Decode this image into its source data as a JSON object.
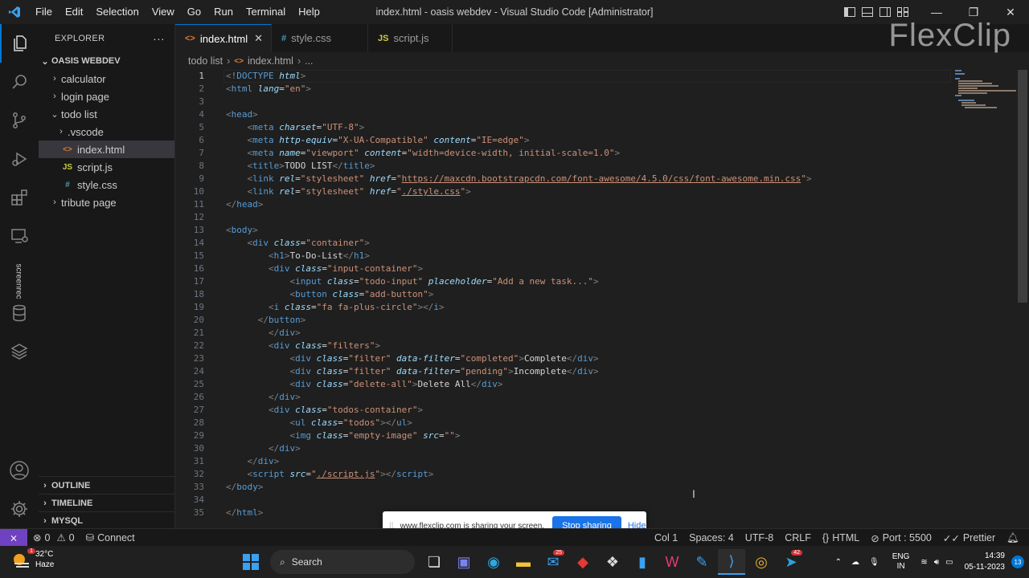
{
  "window": {
    "title": "index.html - oasis webdev - Visual Studio Code [Administrator]",
    "menu": [
      "File",
      "Edit",
      "Selection",
      "View",
      "Go",
      "Run",
      "Terminal",
      "Help"
    ],
    "controls": {
      "minimize": "—",
      "restore": "❐",
      "close": "✕"
    }
  },
  "activity_bar": {
    "items": [
      "files-icon",
      "search-icon",
      "source-control-icon",
      "run-debug-icon",
      "extensions-icon",
      "remote-explorer-icon",
      "database-icon",
      "stack-icon"
    ],
    "bottom": [
      "account-icon",
      "settings-gear-icon"
    ],
    "screenrec_label": "screenrec"
  },
  "sidebar": {
    "title": "EXPLORER",
    "more": "···",
    "root": "OASIS WEBDEV",
    "tree": [
      {
        "label": "calculator",
        "kind": "folder",
        "open": false,
        "depth": 1
      },
      {
        "label": "login page",
        "kind": "folder",
        "open": false,
        "depth": 1
      },
      {
        "label": "todo list",
        "kind": "folder",
        "open": true,
        "depth": 1
      },
      {
        "label": ".vscode",
        "kind": "folder",
        "open": false,
        "depth": 2
      },
      {
        "label": "index.html",
        "kind": "html",
        "depth": 2,
        "selected": true
      },
      {
        "label": "script.js",
        "kind": "js",
        "depth": 2
      },
      {
        "label": "style.css",
        "kind": "css",
        "depth": 2
      },
      {
        "label": "tribute page",
        "kind": "folder",
        "open": false,
        "depth": 1
      }
    ],
    "sections": [
      "OUTLINE",
      "TIMELINE",
      "MYSQL"
    ]
  },
  "tabs": [
    {
      "label": "index.html",
      "icon": "<>",
      "active": true,
      "close": "✕"
    },
    {
      "label": "style.css",
      "icon": "#",
      "active": false
    },
    {
      "label": "script.js",
      "icon": "JS",
      "active": false
    }
  ],
  "breadcrumb": [
    "todo list",
    "index.html",
    "..."
  ],
  "editor": {
    "current_line": 1,
    "lines": [
      [
        [
          "p",
          "<"
        ],
        [
          "t",
          "!DOCTYPE"
        ],
        [
          "x",
          " "
        ],
        [
          "a",
          "html"
        ],
        [
          "p",
          ">"
        ]
      ],
      [
        [
          "p",
          "<"
        ],
        [
          "t",
          "html"
        ],
        [
          "x",
          " "
        ],
        [
          "a",
          "lang"
        ],
        [
          "x",
          "="
        ],
        [
          "s",
          "\"en\""
        ],
        [
          "p",
          ">"
        ]
      ],
      [],
      [
        [
          "p",
          "<"
        ],
        [
          "t",
          "head"
        ],
        [
          "p",
          ">"
        ]
      ],
      [
        [
          "x",
          "    "
        ],
        [
          "p",
          "<"
        ],
        [
          "t",
          "meta"
        ],
        [
          "x",
          " "
        ],
        [
          "a",
          "charset"
        ],
        [
          "x",
          "="
        ],
        [
          "s",
          "\"UTF-8\""
        ],
        [
          "p",
          ">"
        ]
      ],
      [
        [
          "x",
          "    "
        ],
        [
          "p",
          "<"
        ],
        [
          "t",
          "meta"
        ],
        [
          "x",
          " "
        ],
        [
          "a",
          "http-equiv"
        ],
        [
          "x",
          "="
        ],
        [
          "s",
          "\"X-UA-Compatible\""
        ],
        [
          "x",
          " "
        ],
        [
          "a",
          "content"
        ],
        [
          "x",
          "="
        ],
        [
          "s",
          "\"IE=edge\""
        ],
        [
          "p",
          ">"
        ]
      ],
      [
        [
          "x",
          "    "
        ],
        [
          "p",
          "<"
        ],
        [
          "t",
          "meta"
        ],
        [
          "x",
          " "
        ],
        [
          "a",
          "name"
        ],
        [
          "x",
          "="
        ],
        [
          "s",
          "\"viewport\""
        ],
        [
          "x",
          " "
        ],
        [
          "a",
          "content"
        ],
        [
          "x",
          "="
        ],
        [
          "s",
          "\"width=device-width, initial-scale=1.0\""
        ],
        [
          "p",
          ">"
        ]
      ],
      [
        [
          "x",
          "    "
        ],
        [
          "p",
          "<"
        ],
        [
          "t",
          "title"
        ],
        [
          "p",
          ">"
        ],
        [
          "x",
          "TODO LIST"
        ],
        [
          "p",
          "</"
        ],
        [
          "t",
          "title"
        ],
        [
          "p",
          ">"
        ]
      ],
      [
        [
          "x",
          "    "
        ],
        [
          "p",
          "<"
        ],
        [
          "t",
          "link"
        ],
        [
          "x",
          " "
        ],
        [
          "a",
          "rel"
        ],
        [
          "x",
          "="
        ],
        [
          "s",
          "\"stylesheet\""
        ],
        [
          "x",
          " "
        ],
        [
          "a",
          "href"
        ],
        [
          "x",
          "="
        ],
        [
          "s",
          "\""
        ],
        [
          "su",
          "https://maxcdn.bootstrapcdn.com/font-awesome/4.5.0/css/font-awesome.min.css"
        ],
        [
          "s",
          "\""
        ],
        [
          "p",
          ">"
        ]
      ],
      [
        [
          "x",
          "    "
        ],
        [
          "p",
          "<"
        ],
        [
          "t",
          "link"
        ],
        [
          "x",
          " "
        ],
        [
          "a",
          "rel"
        ],
        [
          "x",
          "="
        ],
        [
          "s",
          "\"stylesheet\""
        ],
        [
          "x",
          " "
        ],
        [
          "a",
          "href"
        ],
        [
          "x",
          "="
        ],
        [
          "s",
          "\""
        ],
        [
          "su",
          "./style.css"
        ],
        [
          "s",
          "\""
        ],
        [
          "p",
          ">"
        ]
      ],
      [
        [
          "p",
          "</"
        ],
        [
          "t",
          "head"
        ],
        [
          "p",
          ">"
        ]
      ],
      [],
      [
        [
          "p",
          "<"
        ],
        [
          "t",
          "body"
        ],
        [
          "p",
          ">"
        ]
      ],
      [
        [
          "x",
          "    "
        ],
        [
          "p",
          "<"
        ],
        [
          "t",
          "div"
        ],
        [
          "x",
          " "
        ],
        [
          "a",
          "class"
        ],
        [
          "x",
          "="
        ],
        [
          "s",
          "\"container\""
        ],
        [
          "p",
          ">"
        ]
      ],
      [
        [
          "x",
          "        "
        ],
        [
          "p",
          "<"
        ],
        [
          "t",
          "h1"
        ],
        [
          "p",
          ">"
        ],
        [
          "x",
          "To-Do-List"
        ],
        [
          "p",
          "</"
        ],
        [
          "t",
          "h1"
        ],
        [
          "p",
          ">"
        ]
      ],
      [
        [
          "x",
          "        "
        ],
        [
          "p",
          "<"
        ],
        [
          "t",
          "div"
        ],
        [
          "x",
          " "
        ],
        [
          "a",
          "class"
        ],
        [
          "x",
          "="
        ],
        [
          "s",
          "\"input-container\""
        ],
        [
          "p",
          ">"
        ]
      ],
      [
        [
          "x",
          "            "
        ],
        [
          "p",
          "<"
        ],
        [
          "t",
          "input"
        ],
        [
          "x",
          " "
        ],
        [
          "a",
          "class"
        ],
        [
          "x",
          "="
        ],
        [
          "s",
          "\"todo-input\""
        ],
        [
          "x",
          " "
        ],
        [
          "a",
          "placeholder"
        ],
        [
          "x",
          "="
        ],
        [
          "s",
          "\"Add a new task...\""
        ],
        [
          "p",
          ">"
        ]
      ],
      [
        [
          "x",
          "            "
        ],
        [
          "p",
          "<"
        ],
        [
          "t",
          "button"
        ],
        [
          "x",
          " "
        ],
        [
          "a",
          "class"
        ],
        [
          "x",
          "="
        ],
        [
          "s",
          "\"add-button\""
        ],
        [
          "p",
          ">"
        ]
      ],
      [
        [
          "x",
          "        "
        ],
        [
          "p",
          "<"
        ],
        [
          "t",
          "i"
        ],
        [
          "x",
          " "
        ],
        [
          "a",
          "class"
        ],
        [
          "x",
          "="
        ],
        [
          "s",
          "\"fa fa-plus-circle\""
        ],
        [
          "p",
          "></"
        ],
        [
          "t",
          "i"
        ],
        [
          "p",
          ">"
        ]
      ],
      [
        [
          "x",
          "      "
        ],
        [
          "p",
          "</"
        ],
        [
          "t",
          "button"
        ],
        [
          "p",
          ">"
        ]
      ],
      [
        [
          "x",
          "        "
        ],
        [
          "p",
          "</"
        ],
        [
          "t",
          "div"
        ],
        [
          "p",
          ">"
        ]
      ],
      [
        [
          "x",
          "        "
        ],
        [
          "p",
          "<"
        ],
        [
          "t",
          "div"
        ],
        [
          "x",
          " "
        ],
        [
          "a",
          "class"
        ],
        [
          "x",
          "="
        ],
        [
          "s",
          "\"filters\""
        ],
        [
          "p",
          ">"
        ]
      ],
      [
        [
          "x",
          "            "
        ],
        [
          "p",
          "<"
        ],
        [
          "t",
          "div"
        ],
        [
          "x",
          " "
        ],
        [
          "a",
          "class"
        ],
        [
          "x",
          "="
        ],
        [
          "s",
          "\"filter\""
        ],
        [
          "x",
          " "
        ],
        [
          "a",
          "data-filter"
        ],
        [
          "x",
          "="
        ],
        [
          "s",
          "\"completed\""
        ],
        [
          "p",
          ">"
        ],
        [
          "x",
          "Complete"
        ],
        [
          "p",
          "</"
        ],
        [
          "t",
          "div"
        ],
        [
          "p",
          ">"
        ]
      ],
      [
        [
          "x",
          "            "
        ],
        [
          "p",
          "<"
        ],
        [
          "t",
          "div"
        ],
        [
          "x",
          " "
        ],
        [
          "a",
          "class"
        ],
        [
          "x",
          "="
        ],
        [
          "s",
          "\"filter\""
        ],
        [
          "x",
          " "
        ],
        [
          "a",
          "data-filter"
        ],
        [
          "x",
          "="
        ],
        [
          "s",
          "\"pending\""
        ],
        [
          "p",
          ">"
        ],
        [
          "x",
          "Incomplete"
        ],
        [
          "p",
          "</"
        ],
        [
          "t",
          "div"
        ],
        [
          "p",
          ">"
        ]
      ],
      [
        [
          "x",
          "            "
        ],
        [
          "p",
          "<"
        ],
        [
          "t",
          "div"
        ],
        [
          "x",
          " "
        ],
        [
          "a",
          "class"
        ],
        [
          "x",
          "="
        ],
        [
          "s",
          "\"delete-all\""
        ],
        [
          "p",
          ">"
        ],
        [
          "x",
          "Delete All"
        ],
        [
          "p",
          "</"
        ],
        [
          "t",
          "div"
        ],
        [
          "p",
          ">"
        ]
      ],
      [
        [
          "x",
          "        "
        ],
        [
          "p",
          "</"
        ],
        [
          "t",
          "div"
        ],
        [
          "p",
          ">"
        ]
      ],
      [
        [
          "x",
          "        "
        ],
        [
          "p",
          "<"
        ],
        [
          "t",
          "div"
        ],
        [
          "x",
          " "
        ],
        [
          "a",
          "class"
        ],
        [
          "x",
          "="
        ],
        [
          "s",
          "\"todos-container\""
        ],
        [
          "p",
          ">"
        ]
      ],
      [
        [
          "x",
          "            "
        ],
        [
          "p",
          "<"
        ],
        [
          "t",
          "ul"
        ],
        [
          "x",
          " "
        ],
        [
          "a",
          "class"
        ],
        [
          "x",
          "="
        ],
        [
          "s",
          "\"todos\""
        ],
        [
          "p",
          "></"
        ],
        [
          "t",
          "ul"
        ],
        [
          "p",
          ">"
        ]
      ],
      [
        [
          "x",
          "            "
        ],
        [
          "p",
          "<"
        ],
        [
          "t",
          "img"
        ],
        [
          "x",
          " "
        ],
        [
          "a",
          "class"
        ],
        [
          "x",
          "="
        ],
        [
          "s",
          "\"empty-image\""
        ],
        [
          "x",
          " "
        ],
        [
          "a",
          "src"
        ],
        [
          "x",
          "="
        ],
        [
          "s",
          "\"\""
        ],
        [
          "p",
          ">"
        ]
      ],
      [
        [
          "x",
          "        "
        ],
        [
          "p",
          "</"
        ],
        [
          "t",
          "div"
        ],
        [
          "p",
          ">"
        ]
      ],
      [
        [
          "x",
          "    "
        ],
        [
          "p",
          "</"
        ],
        [
          "t",
          "div"
        ],
        [
          "p",
          ">"
        ]
      ],
      [
        [
          "x",
          "    "
        ],
        [
          "p",
          "<"
        ],
        [
          "t",
          "script"
        ],
        [
          "x",
          " "
        ],
        [
          "a",
          "src"
        ],
        [
          "x",
          "="
        ],
        [
          "s",
          "\""
        ],
        [
          "su",
          "./script.js"
        ],
        [
          "s",
          "\""
        ],
        [
          "p",
          "></"
        ],
        [
          "t",
          "script"
        ],
        [
          "p",
          ">"
        ]
      ],
      [
        [
          "p",
          "</"
        ],
        [
          "t",
          "body"
        ],
        [
          "p",
          ">"
        ]
      ],
      [],
      [
        [
          "p",
          "</"
        ],
        [
          "t",
          "html"
        ],
        [
          "p",
          ">"
        ]
      ]
    ]
  },
  "watermark": "FlexClip",
  "share_banner": {
    "grip": "⁞⁞",
    "message": "www.flexclip.com is sharing your screen.",
    "stop_label": "Stop sharing",
    "hide_label": "Hide"
  },
  "statusbar": {
    "remote": "⨯",
    "errors": "0",
    "warnings": "0",
    "connect": "Connect",
    "position_partial": "Col 1",
    "spaces": "Spaces: 4",
    "encoding": "UTF-8",
    "eol": "CRLF",
    "language": "HTML",
    "port": "Port : 5500",
    "prettier": "Prettier"
  },
  "taskbar": {
    "weather_temp": "32°C",
    "weather_desc": "Haze",
    "weather_badge": "1",
    "search_placeholder": "Search",
    "apps": [
      {
        "name": "task-view-icon",
        "badge": ""
      },
      {
        "name": "teams-icon",
        "badge": ""
      },
      {
        "name": "edge-icon",
        "badge": ""
      },
      {
        "name": "file-explorer-icon",
        "badge": ""
      },
      {
        "name": "mail-icon",
        "badge": "25"
      },
      {
        "name": "app-red-icon",
        "badge": ""
      },
      {
        "name": "dropbox-icon",
        "badge": ""
      },
      {
        "name": "phone-link-icon",
        "badge": ""
      },
      {
        "name": "wps-icon",
        "badge": ""
      },
      {
        "name": "paint-icon",
        "badge": ""
      },
      {
        "name": "vscode-icon",
        "badge": ""
      },
      {
        "name": "chrome-icon",
        "badge": ""
      },
      {
        "name": "telegram-icon",
        "badge": "42"
      }
    ],
    "lang_top": "ENG",
    "lang_bottom": "IN",
    "time": "14:39",
    "date": "05-11-2023",
    "notifications": "13"
  },
  "colors": {
    "accent": "#0078d4",
    "tag": "#569cd6",
    "attribute": "#9cdcfe",
    "string": "#ce9178",
    "remote_bg": "#6f42c1"
  }
}
